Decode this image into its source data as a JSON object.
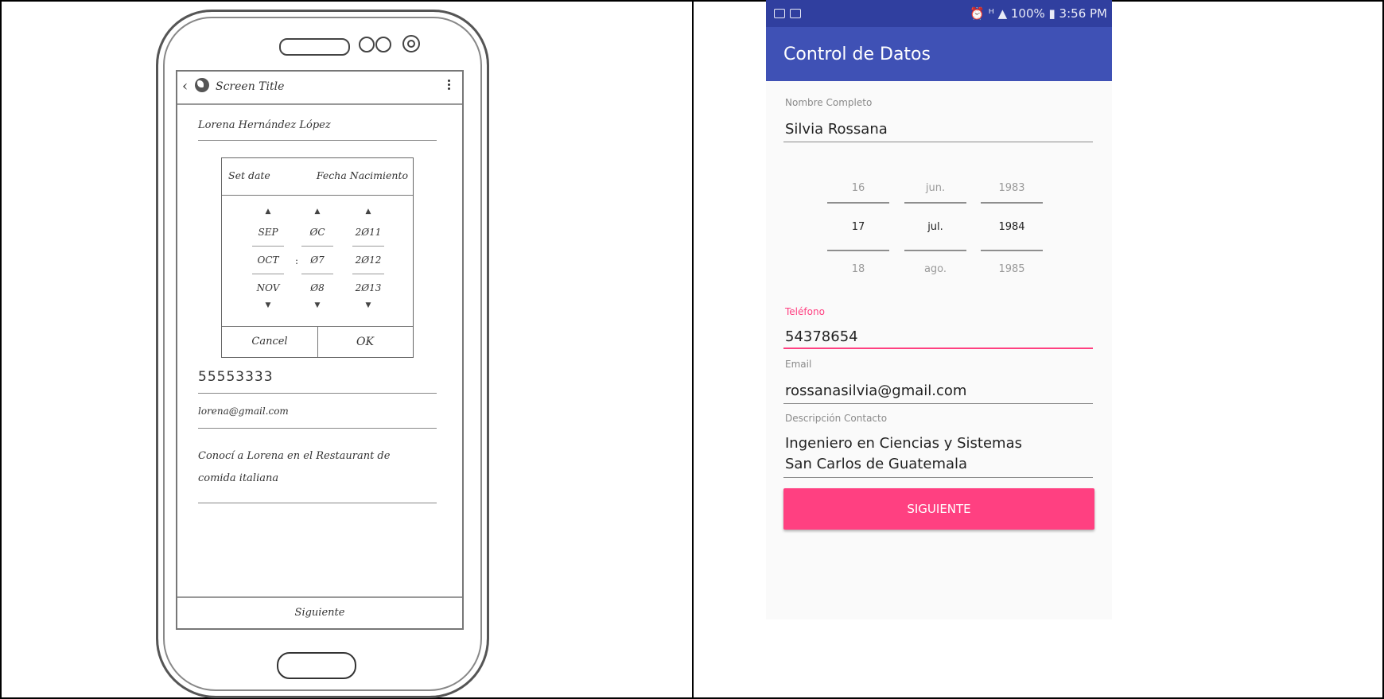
{
  "wireframe": {
    "screen_title": "Screen Title",
    "name_value": "Lorena Hernández López",
    "dialog": {
      "set_date": "Set date",
      "title": "Fecha Nacimiento",
      "months": [
        "SEP",
        "OCT",
        "NOV"
      ],
      "days": [
        "ØC",
        "Ø7",
        "Ø8"
      ],
      "years": [
        "2Ø11",
        "2Ø12",
        "2Ø13"
      ],
      "separator": ":",
      "cancel": "Cancel",
      "ok": "OK"
    },
    "phone_value": "55553333",
    "email_value": "lorena@gmail.com",
    "description_line1": "Conocí a Lorena en el Restaurant de",
    "description_line2": "comida italiana",
    "next_label": "Siguiente"
  },
  "app": {
    "status": {
      "right_text": "⏰ ᴴ ▲ 100% ▮ 3:56 PM"
    },
    "title": "Control de Datos",
    "fields": {
      "name_label": "Nombre Completo",
      "name_value": "Silvia Rossana",
      "phone_label": "Teléfono",
      "phone_value": "54378654",
      "email_label": "Email",
      "email_value": "rossanasilvia@gmail.com",
      "desc_label": "Descripción Contacto",
      "desc_line1": "Ingeniero en Ciencias y Sistemas",
      "desc_line2": "San Carlos de Guatemala"
    },
    "picker": {
      "day": {
        "prev": "16",
        "selected": "17",
        "next": "18"
      },
      "month": {
        "prev": "jun.",
        "selected": "jul.",
        "next": "ago."
      },
      "year": {
        "prev": "1983",
        "selected": "1984",
        "next": "1985"
      }
    },
    "next_button": "SIGUIENTE",
    "colors": {
      "primary": "#3f51b5",
      "primary_dark": "#303f9f",
      "accent": "#ff4081"
    }
  }
}
